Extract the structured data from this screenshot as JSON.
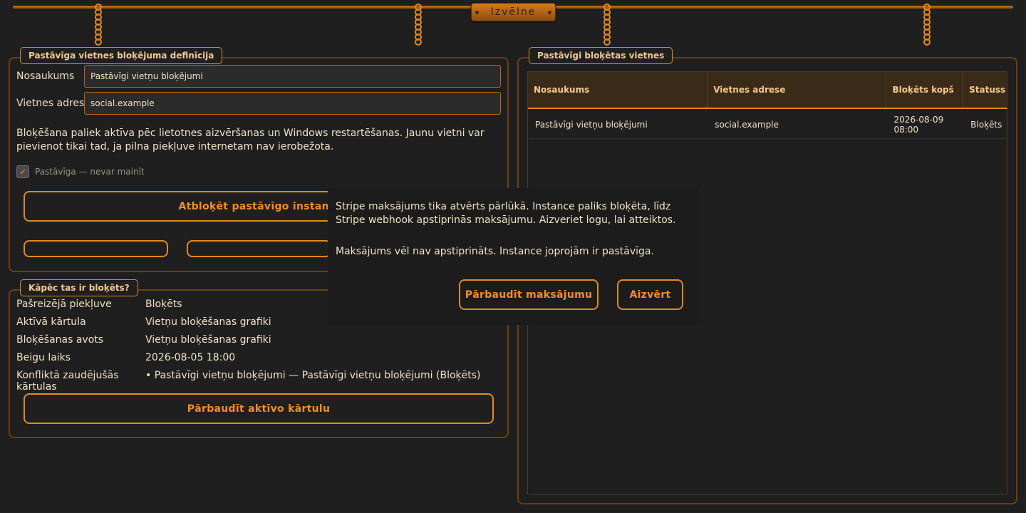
{
  "menu": {
    "label": "Izvēlne"
  },
  "definition": {
    "legend": "Pastāvīga vietnes bloķējuma definīcija",
    "name_label": "Nosaukums",
    "name_value": "Pastāvīgi vietņu bloķējumi",
    "address_label": "Vietnes adrese",
    "address_value": "social.example",
    "description": "Bloķēšana paliek aktīva pēc lietotnes aizvēršanas un Windows restartēšanas. Jaunu vietni var pievienot tikai tad, ja pilna piekļuve internetam nav ierobežota.",
    "checkbox_label": "Pastāvīga — nevar mainīt",
    "checkbox_mark": "✓",
    "unlock_button": "Atbloķēt pastāvīgo instanci"
  },
  "why": {
    "legend": "Kāpēc tas ir bloķēts?",
    "rows": [
      {
        "key": "Pašreizējā piekļuve",
        "value": "Bloķēts"
      },
      {
        "key": "Aktīvā kārtula",
        "value": "Vietņu bloķēšanas grafiki"
      },
      {
        "key": "Bloķēšanas avots",
        "value": "Vietņu bloķēšanas grafiki"
      },
      {
        "key": "Beigu laiks",
        "value": "2026-08-05 18:00"
      },
      {
        "key": "Konfliktā zaudējušās kārtulas",
        "value": "• Pastāvīgi vietņu bloķējumi — Pastāvīgi vietņu bloķējumi (Bloķēts)"
      }
    ],
    "check_button": "Pārbaudīt aktīvo kārtulu"
  },
  "blocked_sites": {
    "legend": "Pastāvīgi bloķētas vietnes",
    "columns": [
      "Nosaukums",
      "Vietnes adrese",
      "Bloķēts kopš",
      "Statuss"
    ],
    "rows": [
      [
        "Pastāvīgi vietņu bloķējumi",
        "social.example",
        "2026-08-09 08:00",
        "Bloķēts"
      ]
    ]
  },
  "dialog": {
    "message": "Stripe maksājums tika atvērts pārlūkā. Instance paliks bloķēta, līdz Stripe webhook apstiprinās maksājumu. Aizveriet logu, lai atteiktos.",
    "status": "Maksājums vēl nav apstiprināts. Instance joprojām ir pastāvīga.",
    "verify_button": "Pārbaudīt maksājumu",
    "close_button": "Aizvērt"
  },
  "colors": {
    "accent": "#e08a1e",
    "background": "#1f1f1f",
    "text": "#f0e2c4",
    "header": "#3a2a18"
  }
}
